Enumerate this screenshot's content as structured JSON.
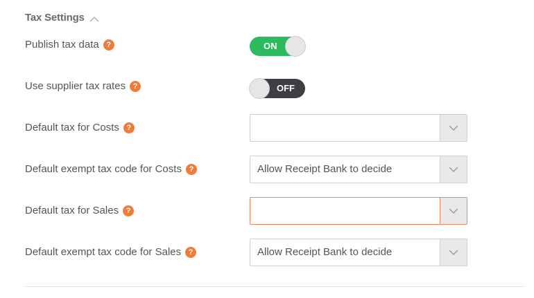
{
  "section": {
    "title": "Tax Settings",
    "collapse_icon": "chevron-up-icon"
  },
  "rows": [
    {
      "label": "Publish tax data",
      "help": "?",
      "control": "toggle",
      "state": "ON"
    },
    {
      "label": "Use supplier tax rates",
      "help": "?",
      "control": "toggle",
      "state": "OFF"
    },
    {
      "label": "Default tax for Costs",
      "help": "?",
      "control": "select",
      "value": ""
    },
    {
      "label": "Default exempt tax code for Costs",
      "help": "?",
      "control": "select",
      "value": "Allow Receipt Bank to decide"
    },
    {
      "label": "Default tax for Sales",
      "help": "?",
      "control": "select",
      "value": "",
      "invalid": true
    },
    {
      "label": "Default exempt tax code for Sales",
      "help": "?",
      "control": "select",
      "value": "Allow Receipt Bank to decide"
    }
  ],
  "colors": {
    "toggle_on": "#2dbb5d",
    "toggle_off": "#3d3f44",
    "help_icon": "#ee7d3b",
    "invalid_border": "#e9875a"
  }
}
